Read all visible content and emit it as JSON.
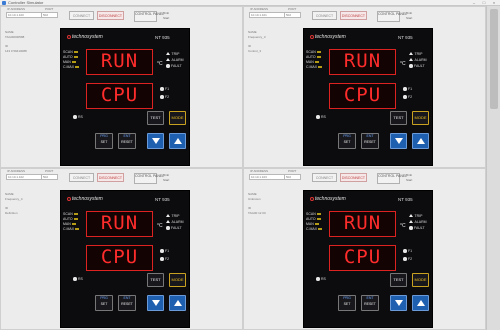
{
  "window": {
    "title": "Controller Simulator"
  },
  "panels": [
    {
      "ip_label": "IP ADDRESS",
      "ip_value": "10.10.1.100",
      "port_label": "PORT",
      "port_value": "502",
      "connect_label": "CONNECT",
      "disconnect_label": "DISCONNECT",
      "control_panel_label": "CONTROL PANEL",
      "status_1": "Bmb",
      "status_2": "Start",
      "name_label": "NAME",
      "name_value": "TAG00000588",
      "desc_label": "ID",
      "desc_value": "143 0 59410088",
      "brand": "technosystem",
      "model": "NT 935",
      "indicators": [
        "SCAN",
        "AUTO",
        "MAN",
        "C.MAX"
      ],
      "display_top": "RUN",
      "display_bottom": "CPU",
      "unit": "°C",
      "status_labels": [
        "TRIP",
        "ALARM",
        "FAULT"
      ],
      "f_labels": [
        "F1",
        "F2"
      ],
      "rs_label": "RS",
      "test_label": "TEST",
      "mode_label": "MODE",
      "prg_label": "PRG",
      "set_label": "SET",
      "ent_label": "ENT",
      "reset_label": "RESET"
    },
    {
      "ip_label": "IP ADDRESS",
      "ip_value": "10.10.1.101",
      "port_label": "PORT",
      "port_value": "502",
      "connect_label": "CONNECT",
      "disconnect_label": "DISCONNECT",
      "control_panel_label": "CONTROL PANEL",
      "status_1": "Bmb",
      "status_2": "Start",
      "name_label": "NAME",
      "name_value": "Frequency_3",
      "desc_label": "ID",
      "desc_value": "Control_3",
      "brand": "technosystem",
      "model": "NT 935",
      "indicators": [
        "SCAN",
        "AUTO",
        "MAN",
        "C.MAX"
      ],
      "display_top": "RUN",
      "display_bottom": "CPU",
      "unit": "°C",
      "status_labels": [
        "TRIP",
        "ALARM",
        "FAULT"
      ],
      "f_labels": [
        "F1",
        "F2"
      ],
      "rs_label": "RS",
      "test_label": "TEST",
      "mode_label": "MODE",
      "prg_label": "PRG",
      "set_label": "SET",
      "ent_label": "ENT",
      "reset_label": "RESET"
    },
    {
      "ip_label": "IP ADDRESS",
      "ip_value": "10.10.1.102",
      "port_label": "PORT",
      "port_value": "502",
      "connect_label": "CONNECT",
      "disconnect_label": "DISCONNECT",
      "control_panel_label": "CONTROL PANEL",
      "status_1": "Bmb",
      "status_2": "Start",
      "name_label": "NAME",
      "name_value": "Frequency_4",
      "desc_label": "ID",
      "desc_value": "Definition",
      "brand": "technosystem",
      "model": "NT 935",
      "indicators": [
        "SCAN",
        "AUTO",
        "MAN",
        "C.MAX"
      ],
      "display_top": "RUN",
      "display_bottom": "CPU",
      "unit": "°C",
      "status_labels": [
        "TRIP",
        "ALARM",
        "FAULT"
      ],
      "f_labels": [
        "F1",
        "F2"
      ],
      "rs_label": "RS",
      "test_label": "TEST",
      "mode_label": "MODE",
      "prg_label": "PRG",
      "set_label": "SET",
      "ent_label": "ENT",
      "reset_label": "RESET"
    },
    {
      "ip_label": "IP ADDRESS",
      "ip_value": "10.10.1.103",
      "port_label": "PORT",
      "port_value": "502",
      "connect_label": "CONNECT",
      "disconnect_label": "DISCONNECT",
      "control_panel_label": "CONTROL PANEL",
      "status_1": "Bmb",
      "status_2": "Start",
      "name_label": "NAME",
      "name_value": "Unknown",
      "desc_label": "ID",
      "desc_value": "TAG00 12 00",
      "brand": "technosystem",
      "model": "NT 935",
      "indicators": [
        "SCAN",
        "AUTO",
        "MAN",
        "C.MAX"
      ],
      "display_top": "RUN",
      "display_bottom": "CPU",
      "unit": "°C",
      "status_labels": [
        "TRIP",
        "ALARM",
        "FAULT"
      ],
      "f_labels": [
        "F1",
        "F2"
      ],
      "rs_label": "RS",
      "test_label": "TEST",
      "mode_label": "MODE",
      "prg_label": "PRG",
      "set_label": "SET",
      "ent_label": "ENT",
      "reset_label": "RESET"
    }
  ]
}
